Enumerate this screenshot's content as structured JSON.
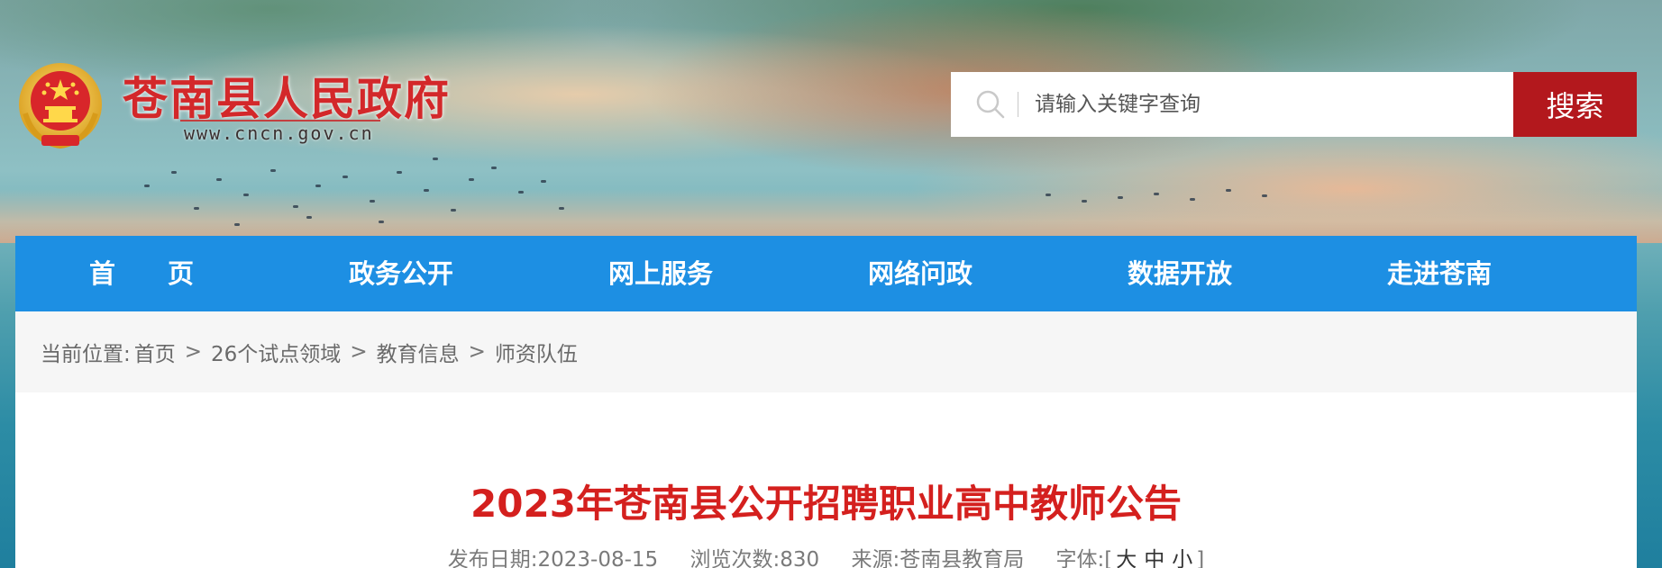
{
  "site": {
    "title": "苍南县人民政府",
    "url": "www.cncn.gov.cn"
  },
  "search": {
    "placeholder": "请输入关键字查询",
    "button_label": "搜索"
  },
  "nav": {
    "items": [
      {
        "label": "首　　页"
      },
      {
        "label": "政务公开"
      },
      {
        "label": "网上服务"
      },
      {
        "label": "网络问政"
      },
      {
        "label": "数据开放"
      },
      {
        "label": "走进苍南"
      }
    ]
  },
  "breadcrumb": {
    "prefix": "当前位置:",
    "items": [
      "首页",
      "26个试点领域",
      "教育信息",
      "师资队伍"
    ],
    "separator": ">"
  },
  "article": {
    "title": "2023年苍南县公开招聘职业高中教师公告",
    "date_label": "发布日期:",
    "date": "2023-08-15",
    "views_label": "浏览次数:",
    "views": "830",
    "source_label": "来源:",
    "source": "苍南县教育局",
    "font_label": "字体:",
    "font_open": "[",
    "font_large": "大",
    "font_medium": "中",
    "font_small": "小",
    "font_close": "]"
  },
  "colors": {
    "nav_blue": "#1d8fe3",
    "brand_red": "#d3282a",
    "search_button": "#b3181d",
    "title_red": "#d4201e"
  },
  "icons": {
    "emblem": "national-emblem-icon",
    "search": "search-icon"
  }
}
